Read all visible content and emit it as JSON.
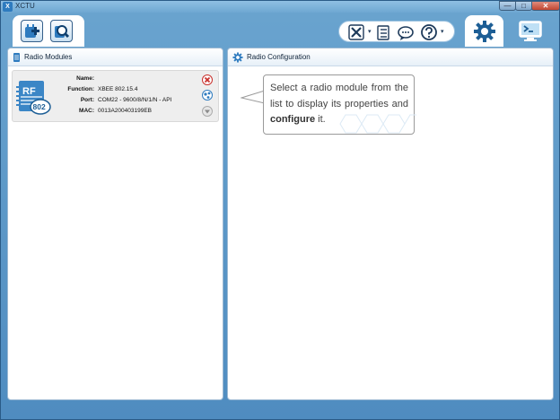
{
  "window": {
    "title": "XCTU",
    "icon": "xctu-app-icon"
  },
  "titlebar_buttons": {
    "minimize": "—",
    "maximize": "□",
    "close": "✕"
  },
  "toolbar": {
    "add_device_icon": "add-device-icon",
    "discover_icon": "discover-devices-icon",
    "tools_icon": "tools-icon",
    "profiles_icon": "configuration-profiles-icon",
    "chat_icon": "feedback-chat-icon",
    "help_icon": "help-icon",
    "caret": "▾",
    "config_mode_icon": "gear-icon",
    "console_mode_icon": "console-monitor-icon"
  },
  "left_panel": {
    "title": "Radio Modules",
    "module": {
      "icon_label_rf": "RF",
      "icon_label_num": "802",
      "fields": [
        {
          "label": "Name:",
          "value": ""
        },
        {
          "label": "Function:",
          "value": "XBEE 802.15.4"
        },
        {
          "label": "Port:",
          "value": "COM22 - 9600/8/N/1/N - API"
        },
        {
          "label": "MAC:",
          "value": "0013A200403199EB"
        }
      ]
    }
  },
  "right_panel": {
    "title": "Radio Configuration",
    "hint_before": "Select a radio module from the list to display its properties and ",
    "hint_bold": "configure",
    "hint_after": " it."
  },
  "colors": {
    "accent": "#2e7bbf",
    "frame": "#4f8cc0",
    "close_red": "#c14632"
  }
}
